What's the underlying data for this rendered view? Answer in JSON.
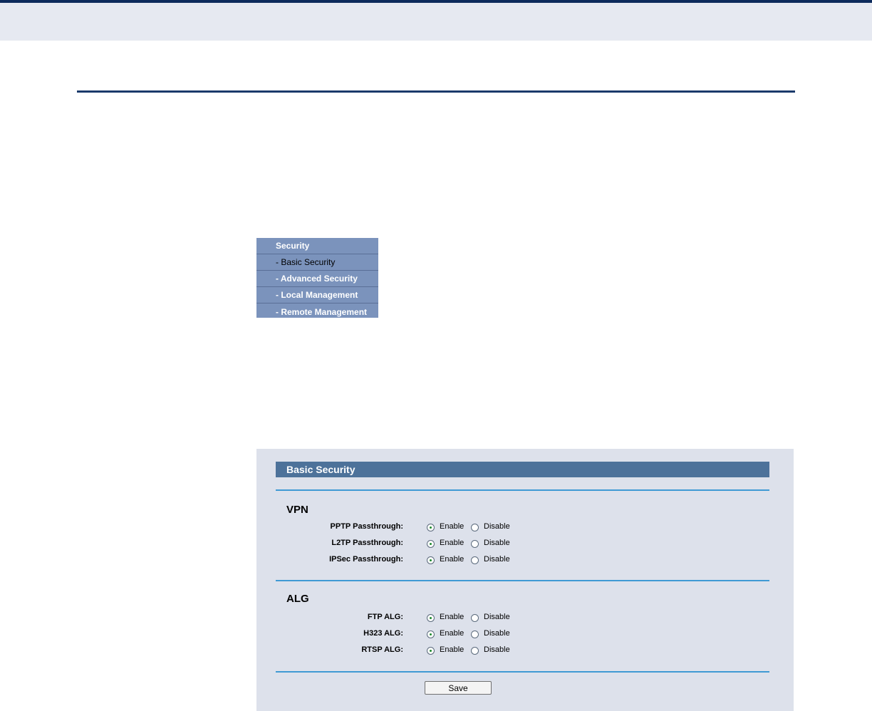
{
  "menu": {
    "items": [
      {
        "label": "Security"
      },
      {
        "label": "- Basic Security"
      },
      {
        "label": "- Advanced Security"
      },
      {
        "label": "- Local Management"
      },
      {
        "label": "- Remote Management"
      }
    ]
  },
  "panel": {
    "title": "Basic Security",
    "vpn": {
      "title": "VPN",
      "rows": [
        {
          "label": "PPTP Passthrough:",
          "selected": "Enable"
        },
        {
          "label": "L2TP Passthrough:",
          "selected": "Enable"
        },
        {
          "label": "IPSec Passthrough:",
          "selected": "Enable"
        }
      ]
    },
    "alg": {
      "title": "ALG",
      "rows": [
        {
          "label": "FTP ALG:",
          "selected": "Enable"
        },
        {
          "label": "H323 ALG:",
          "selected": "Enable"
        },
        {
          "label": "RTSP ALG:",
          "selected": "Enable"
        }
      ]
    },
    "options": {
      "enable": "Enable",
      "disable": "Disable"
    },
    "save_label": "Save"
  },
  "colors": {
    "menu_bg": "#7b93bc",
    "panel_bg": "#dde1eb",
    "title_bar": "#4d729a",
    "rule": "#3f9ad4",
    "header_rule": "#1b3a6b"
  }
}
